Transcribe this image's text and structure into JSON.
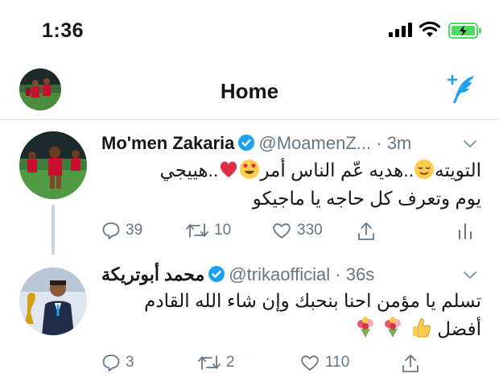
{
  "status_bar": {
    "time": "1:36"
  },
  "header": {
    "title": "Home"
  },
  "tweets": [
    {
      "name": "Mo'men Zakaria",
      "handle": "@MoamenZ...",
      "separator": "·",
      "age": "3m",
      "text_line1_a": "التويته",
      "text_line1_b": "..هديه عّم الناس أمر",
      "text_line1_c": "..هييجي",
      "text_line2": "يوم وتعرف كل حاجه يا ماجيكو",
      "replies": "39",
      "retweets": "10",
      "likes": "330"
    },
    {
      "name": "محمد أبوتريكة",
      "handle": "@trikaofficial",
      "separator": "·",
      "age": "36s",
      "text_line1": "تسلم يا مؤمن احنا بنحبك وإن شاء الله القادم",
      "text_line2": "أفضل",
      "replies": "3",
      "retweets": "2",
      "likes": "110"
    }
  ],
  "colors": {
    "accent": "#1da1f2",
    "muted": "#657786",
    "battery": "#4cd964",
    "red_kit": "#c8102e"
  }
}
